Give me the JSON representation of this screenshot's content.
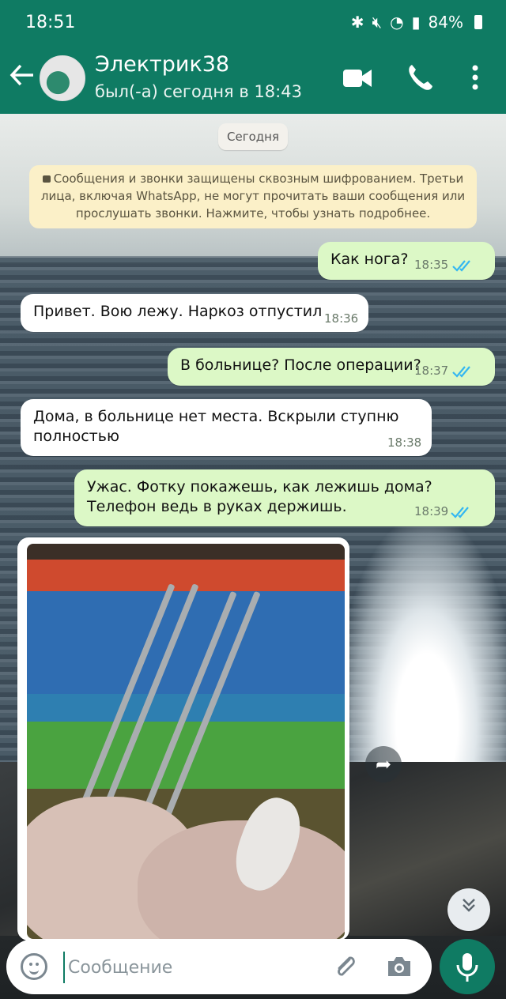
{
  "status_bar": {
    "time": "18:51",
    "battery": "84%"
  },
  "header": {
    "contact_name": "Электрик38",
    "last_seen": "был(-а) сегодня в 18:43"
  },
  "date_chip": "Сегодня",
  "encryption_notice": "Сообщения и звонки защищены сквозным шифрованием. Третьи лица, включая WhatsApp, не могут прочитать ваши сообщения или прослушать звонки. Нажмите, чтобы узнать подробнее.",
  "messages": [
    {
      "direction": "out",
      "text": "Как нога?",
      "time": "18:35",
      "read": true
    },
    {
      "direction": "in",
      "text": "Привет. Вою лежу. Наркоз отпустил",
      "time": "18:36"
    },
    {
      "direction": "out",
      "text": "В больнице? После операции?",
      "time": "18:37",
      "read": true
    },
    {
      "direction": "in",
      "line1": "Дома, в больнице нет места. Вскрыли ступню",
      "line2": "полностью",
      "time": "18:38"
    },
    {
      "direction": "out",
      "line1": "Ужас. Фотку покажешь, как лежишь дома?",
      "line2": "Телефон ведь в руках держишь.",
      "time": "18:39",
      "read": true
    }
  ],
  "photo_message": {
    "direction": "in"
  },
  "input": {
    "placeholder": "Сообщение",
    "value": ""
  },
  "colors": {
    "primary": "#0f7b63",
    "outgoing_bubble": "#dcf8c6",
    "incoming_bubble": "#ffffff",
    "read_ticks": "#34b7f1",
    "notice_bg": "#fbf0c8"
  }
}
